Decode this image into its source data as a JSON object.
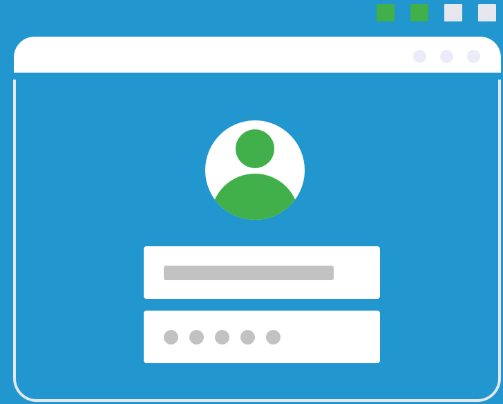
{
  "colors": {
    "background": "#2196cf",
    "window": "#ffffff",
    "window_border": "#e6e6ee",
    "window_dot": "#ececf8",
    "accent": "#41b04a",
    "step_pending": "#e6e6ee",
    "placeholder": "#c2c2c2"
  },
  "steps": [
    {
      "state": "complete",
      "color": "#41b04a"
    },
    {
      "state": "complete",
      "color": "#41b04a"
    },
    {
      "state": "pending",
      "color": "#e6e6ee"
    },
    {
      "state": "pending",
      "color": "#e6e6ee"
    }
  ],
  "window_controls": [
    "minimize-dot",
    "maximize-dot",
    "close-dot"
  ],
  "avatar": {
    "icon": "user-icon",
    "color": "#41b04a"
  },
  "username_field": {
    "icon": "text-placeholder-bar"
  },
  "password_field": {
    "masked_char_count": 5,
    "icon": "password-dot"
  }
}
